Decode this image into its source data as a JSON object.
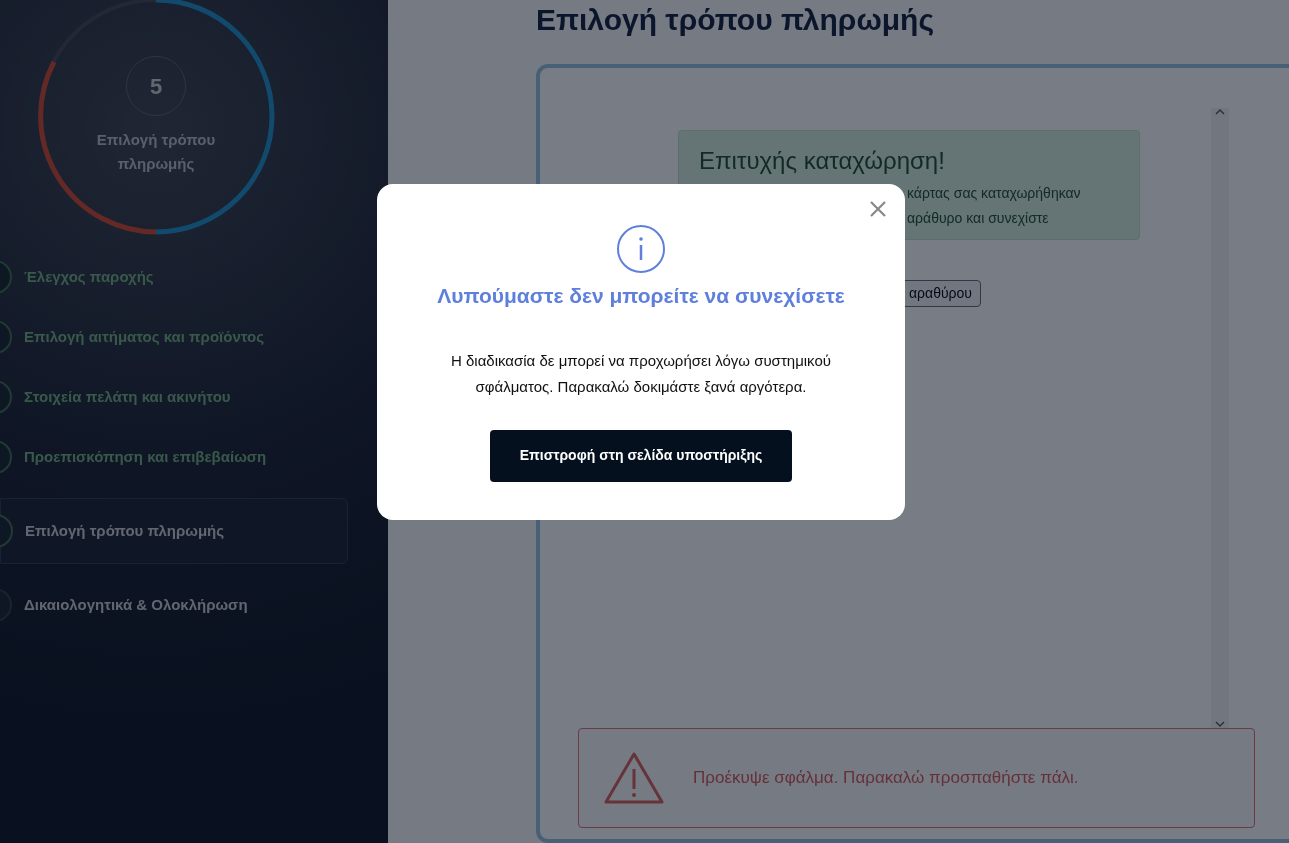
{
  "progress": {
    "number": "5",
    "label": "Επιλογή τρόπου πληρωμής"
  },
  "steps": [
    {
      "label": "Έλεγχος παροχής",
      "completed": true,
      "selected": false
    },
    {
      "label": "Επιλογή αιτήματος και προϊόντος",
      "completed": true,
      "selected": false
    },
    {
      "label": "Στοιχεία πελάτη και ακινήτου",
      "completed": true,
      "selected": false
    },
    {
      "label": "Προεπισκόπηση και επιβεβαίωση",
      "completed": true,
      "selected": false
    },
    {
      "label": "Επιλογή τρόπου πληρωμής",
      "completed": true,
      "selected": true
    },
    {
      "label": "Δικαιολογητικά & Ολοκλήρωση",
      "completed": false,
      "selected": false
    }
  ],
  "page_title": "Επιλογή τρόπου πληρωμής",
  "success_alert": {
    "title": "Επιτυχής καταχώρηση!",
    "lines": [
      "κάρτας σας καταχωρήθηκαν",
      "αράθυρο και συνεχίστε"
    ],
    "button": "αραθύρου"
  },
  "error_alert": {
    "text": "Προέκυψε σφάλμα. Παρακαλώ προσπαθήστε πάλι."
  },
  "modal": {
    "title": "Λυπούμαστε δεν μπορείτε να συνεχίσετε",
    "message": "Η διαδικασία δε μπορεί να προχωρήσει λόγω συστημικού σφάλματος. Παρακαλώ δοκιμάστε ξανά αργότερα.",
    "button": "Επιστροφή στη σελίδα υποστήριξης"
  }
}
